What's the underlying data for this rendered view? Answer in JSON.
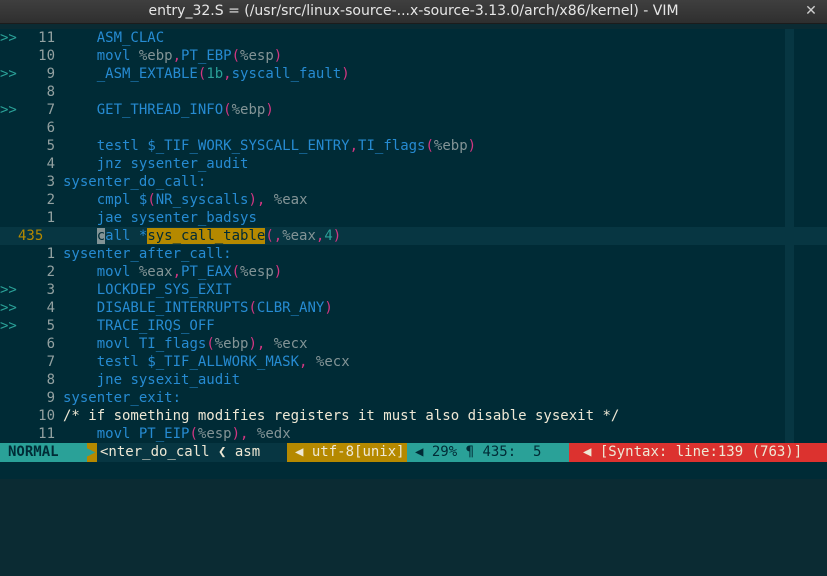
{
  "window": {
    "title": "entry_32.S = (/usr/src/linux-source-...x-source-3.13.0/arch/x86/kernel) - VIM"
  },
  "editor": {
    "lines": [
      {
        "sign": ">>",
        "num": "11",
        "indent": "    ",
        "text": "ASM_CLAC"
      },
      {
        "sign": "",
        "num": "10",
        "indent": "    ",
        "text": "movl %ebp,PT_EBP(%esp)"
      },
      {
        "sign": ">>",
        "num": "9",
        "indent": "    ",
        "text": "_ASM_EXTABLE(1b,syscall_fault)"
      },
      {
        "sign": "",
        "num": "8",
        "indent": "",
        "text": ""
      },
      {
        "sign": ">>",
        "num": "7",
        "indent": "    ",
        "text": "GET_THREAD_INFO(%ebp)"
      },
      {
        "sign": "",
        "num": "6",
        "indent": "",
        "text": ""
      },
      {
        "sign": "",
        "num": "5",
        "indent": "    ",
        "text": "testl $_TIF_WORK_SYSCALL_ENTRY,TI_flags(%ebp)"
      },
      {
        "sign": "",
        "num": "4",
        "indent": "    ",
        "text": "jnz sysenter_audit"
      },
      {
        "sign": "",
        "num": "3",
        "indent": "",
        "text": "sysenter_do_call:"
      },
      {
        "sign": "",
        "num": "2",
        "indent": "    ",
        "text": "cmpl $(NR_syscalls), %eax"
      },
      {
        "sign": "",
        "num": "1",
        "indent": "    ",
        "text": "jae sysenter_badsys"
      },
      {
        "sign": "",
        "num": "435",
        "indent": "    ",
        "text": "call *sys_call_table(,%eax,4)",
        "current": true
      },
      {
        "sign": "",
        "num": "1",
        "indent": "",
        "text": "sysenter_after_call:"
      },
      {
        "sign": "",
        "num": "2",
        "indent": "    ",
        "text": "movl %eax,PT_EAX(%esp)"
      },
      {
        "sign": ">>",
        "num": "3",
        "indent": "    ",
        "text": "LOCKDEP_SYS_EXIT"
      },
      {
        "sign": ">>",
        "num": "4",
        "indent": "    ",
        "text": "DISABLE_INTERRUPTS(CLBR_ANY)"
      },
      {
        "sign": ">>",
        "num": "5",
        "indent": "    ",
        "text": "TRACE_IRQS_OFF"
      },
      {
        "sign": "",
        "num": "6",
        "indent": "    ",
        "text": "movl TI_flags(%ebp), %ecx"
      },
      {
        "sign": "",
        "num": "7",
        "indent": "    ",
        "text": "testl $_TIF_ALLWORK_MASK, %ecx"
      },
      {
        "sign": "",
        "num": "8",
        "indent": "    ",
        "text": "jne sysexit_audit"
      },
      {
        "sign": "",
        "num": "9",
        "indent": "",
        "text": "sysenter_exit:"
      },
      {
        "sign": "",
        "num": "10",
        "indent": "",
        "text": "/* if something modifies registers it must also disable sysexit */"
      },
      {
        "sign": "",
        "num": "11",
        "indent": "    ",
        "text": "movl PT_EIP(%esp), %edx"
      }
    ]
  },
  "statusline": {
    "mode": "NORMAL",
    "sep_glyph": "▶",
    "context": "<nter_do_call ❮ asm",
    "context_sep": "◀",
    "encoding": "utf-8[unix]",
    "encoding_sep": "◀",
    "position": "29% ¶ 435:  5",
    "syntax_sep": "◀",
    "syntax": "[Syntax: line:139 (763)]"
  },
  "colors": {
    "background": "#002b36",
    "line_number": "#93a1a1",
    "sign": "#2aa198",
    "keyword": "#268bd2",
    "string": "#2aa198",
    "comment": "#eee8d5",
    "highlight": "#b58900",
    "mode_bg": "#2aa198",
    "error_bg": "#dc322f"
  }
}
